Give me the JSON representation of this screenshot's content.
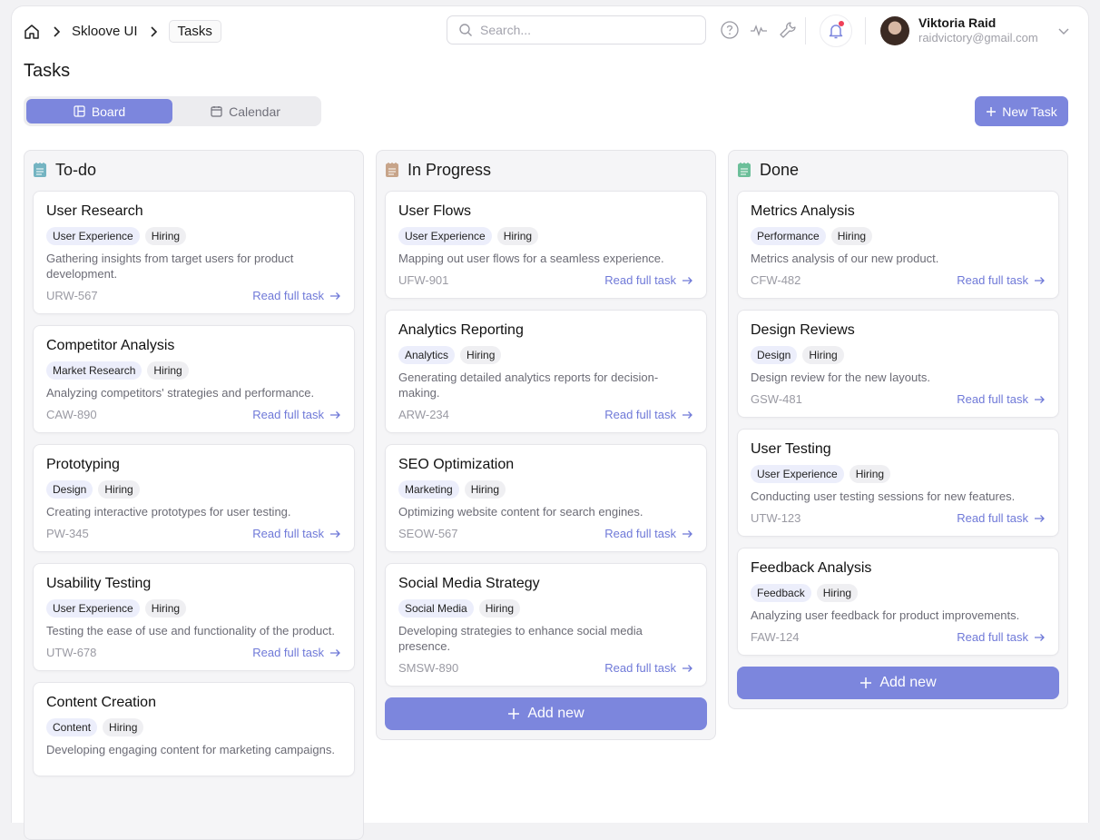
{
  "breadcrumb": {
    "root": "Skloove UI",
    "current": "Tasks"
  },
  "search": {
    "placeholder": "Search..."
  },
  "user": {
    "name": "Viktoria Raid",
    "email": "raidvictory@gmail.com"
  },
  "page": {
    "title": "Tasks"
  },
  "view_toggle": {
    "board": "Board",
    "calendar": "Calendar",
    "selected": "Board"
  },
  "new_task_label": "New Task",
  "accent_color": "#7c86dd",
  "columns": [
    {
      "title": "To-do",
      "icon": "notepad-icon",
      "icon_color": "#74b4c2",
      "cards": [
        {
          "title": "User Research",
          "tags": [
            "User Experience",
            "Hiring"
          ],
          "desc": "Gathering insights from target users for product development.",
          "code": "URW-567",
          "link": "Read full task"
        },
        {
          "title": "Competitor Analysis",
          "tags": [
            "Market Research",
            "Hiring"
          ],
          "desc": "Analyzing competitors' strategies and performance.",
          "code": "CAW-890",
          "link": "Read full task"
        },
        {
          "title": "Prototyping",
          "tags": [
            "Design",
            "Hiring"
          ],
          "desc": "Creating interactive prototypes for user testing.",
          "code": "PW-345",
          "link": "Read full task"
        },
        {
          "title": "Usability Testing",
          "tags": [
            "User Experience",
            "Hiring"
          ],
          "desc": "Testing the ease of use and functionality of the product.",
          "code": "UTW-678",
          "link": "Read full task"
        },
        {
          "title": "Content Creation",
          "tags": [
            "Content",
            "Hiring"
          ],
          "desc": "Developing engaging content for marketing campaigns.",
          "code": "",
          "link": ""
        }
      ]
    },
    {
      "title": "In Progress",
      "icon": "notepad-icon",
      "icon_color": "#c7a48a",
      "cards": [
        {
          "title": "User Flows",
          "tags": [
            "User Experience",
            "Hiring"
          ],
          "desc": "Mapping out user flows for a seamless experience.",
          "code": "UFW-901",
          "link": "Read full task"
        },
        {
          "title": "Analytics Reporting",
          "tags": [
            "Analytics",
            "Hiring"
          ],
          "desc": "Generating detailed analytics reports for decision-making.",
          "code": "ARW-234",
          "link": "Read full task"
        },
        {
          "title": "SEO Optimization",
          "tags": [
            "Marketing",
            "Hiring"
          ],
          "desc": "Optimizing website content for search engines.",
          "code": "SEOW-567",
          "link": "Read full task"
        },
        {
          "title": "Social Media Strategy",
          "tags": [
            "Social Media",
            "Hiring"
          ],
          "desc": "Developing strategies to enhance social media presence.",
          "code": "SMSW-890",
          "link": "Read full task"
        }
      ],
      "add_label": "Add new"
    },
    {
      "title": "Done",
      "icon": "notepad-icon",
      "icon_color": "#6cbf9a",
      "cards": [
        {
          "title": "Metrics Analysis",
          "tags": [
            "Performance",
            "Hiring"
          ],
          "desc": "Metrics analysis of our new product.",
          "code": "CFW-482",
          "link": "Read full task"
        },
        {
          "title": "Design Reviews",
          "tags": [
            "Design",
            "Hiring"
          ],
          "desc": "Design review for the new layouts.",
          "code": "GSW-481",
          "link": "Read full task"
        },
        {
          "title": "User Testing",
          "tags": [
            "User Experience",
            "Hiring"
          ],
          "desc": "Conducting user testing sessions for new features.",
          "code": "UTW-123",
          "link": "Read full task"
        },
        {
          "title": "Feedback Analysis",
          "tags": [
            "Feedback",
            "Hiring"
          ],
          "desc": "Analyzing user feedback for product improvements.",
          "code": "FAW-124",
          "link": "Read full task"
        }
      ],
      "add_label": "Add new"
    }
  ]
}
